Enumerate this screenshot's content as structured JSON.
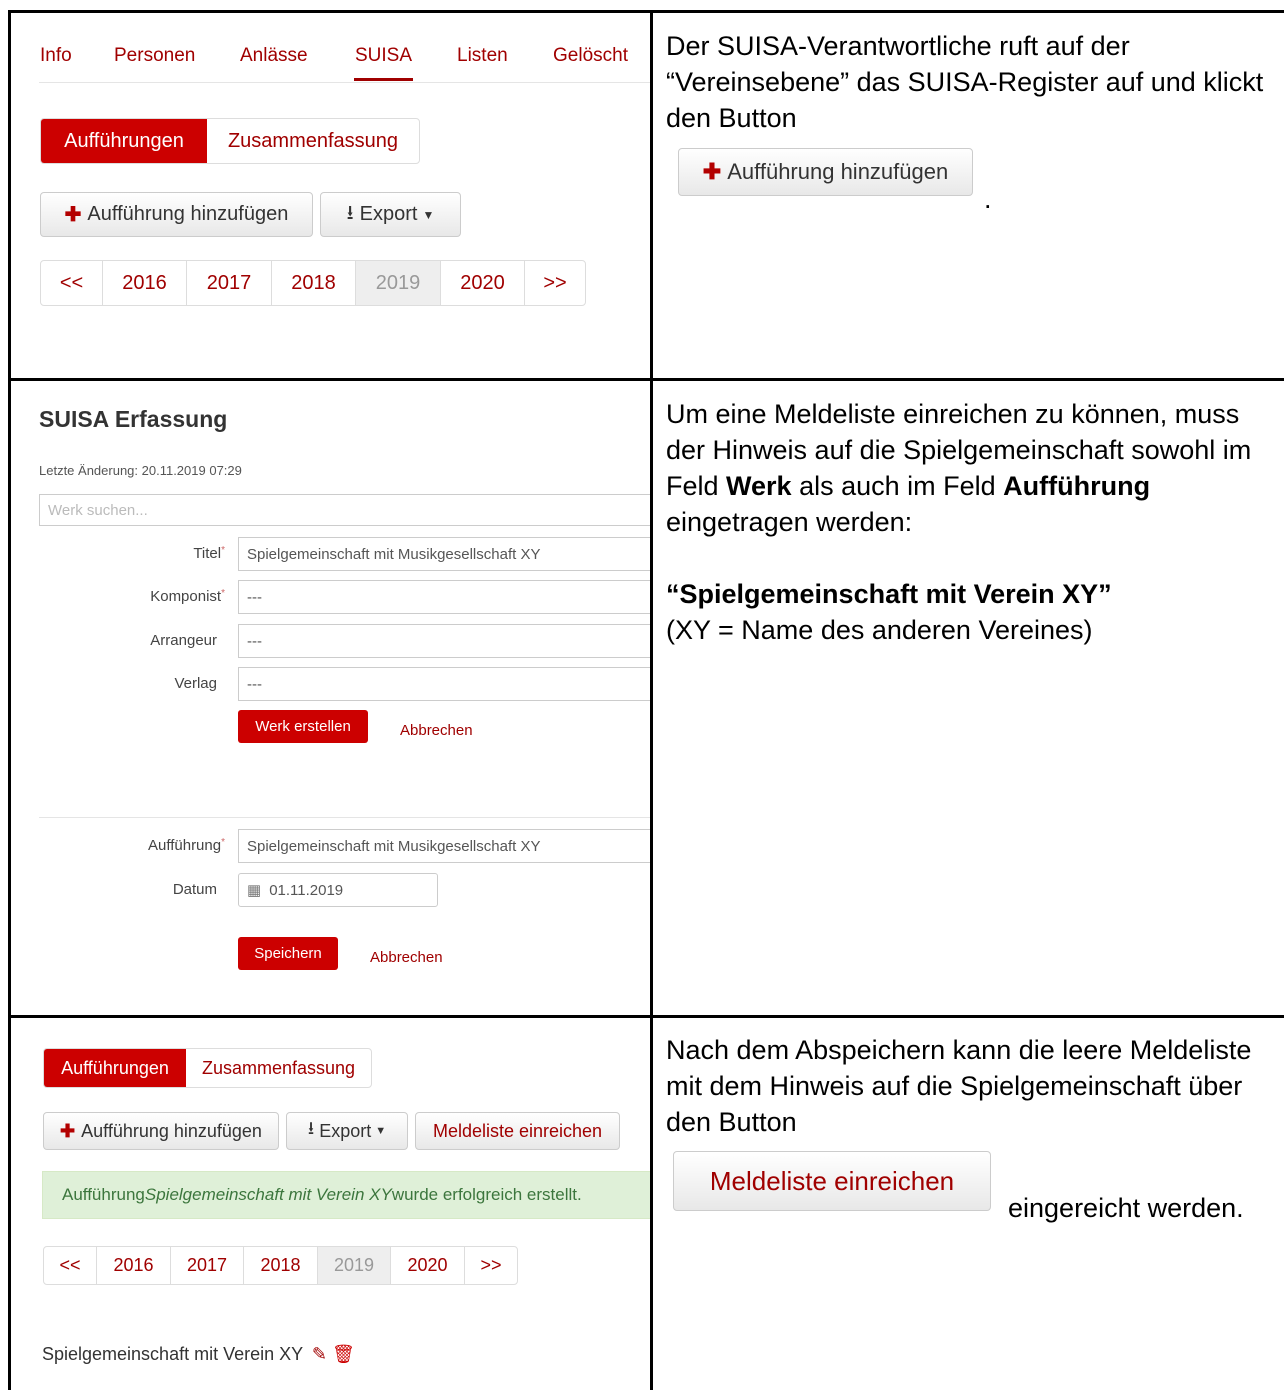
{
  "row1": {
    "nav": [
      "Info",
      "Personen",
      "Anlässe",
      "SUISA",
      "Listen",
      "Gelöscht"
    ],
    "tabs": {
      "active": "Aufführungen",
      "other": "Zusammenfassung"
    },
    "add_button": "Aufführung hinzufügen",
    "export_button": "Export",
    "pager": [
      "<<",
      "2016",
      "2017",
      "2018",
      "2019",
      "2020",
      ">>"
    ],
    "pager_active": "2019",
    "text": "Der SUISA-Verantwortliche ruft auf der “Vereinsebene” das SUISA-Register auf und klickt den Button",
    "inline_button": "Aufführung hinzufügen",
    "trailing_dot": "."
  },
  "row2": {
    "title": "SUISA Erfassung",
    "last_change": "Letzte Änderung: 20.11.2019 07:29",
    "search_placeholder": "Werk suchen...",
    "fields": [
      {
        "label": "Titel",
        "required": "*",
        "value": "Spielgemeinschaft mit Musikgesellschaft XY"
      },
      {
        "label": "Komponist",
        "required": "*",
        "value": "---"
      },
      {
        "label": "Arrangeur",
        "required": "",
        "value": "---"
      },
      {
        "label": "Verlag",
        "required": "",
        "value": "---"
      }
    ],
    "create_button": "Werk erstellen",
    "cancel_link": "Abbrechen",
    "performance_label": "Aufführung",
    "performance_required": "*",
    "performance_value": "Spielgemeinschaft mit Musikgesellschaft XY",
    "date_label": "Datum",
    "date_value": "01.11.2019",
    "save_button": "Speichern",
    "cancel_link2": "Abbrechen",
    "text1_a": "Um eine Meldeliste einreichen zu können, muss der Hinweis auf die Spielgemeinschaft sowohl im Feld ",
    "text1_bold1": "Werk",
    "text1_b": " als auch im Feld ",
    "text1_bold2": "Aufführung",
    "text1_c": " eingetragen werden:",
    "text2_bold": "“Spielgemeinschaft mit Verein XY”",
    "text3": "(XY = Name des anderen Vereines)"
  },
  "row3": {
    "tabs": {
      "active": "Aufführungen",
      "other": "Zusammenfassung"
    },
    "add_button": "Aufführung hinzufügen",
    "export_button": "Export",
    "submit_button": "Meldeliste einreichen",
    "alert_a": "Aufführung ",
    "alert_em": "Spielgemeinschaft mit Verein XY",
    "alert_b": " wurde erfolgreich erstellt.",
    "pager": [
      "<<",
      "2016",
      "2017",
      "2018",
      "2019",
      "2020",
      ">>"
    ],
    "pager_active": "2019",
    "entry": "Spielgemeinschaft mit Verein XY",
    "text": "Nach dem Abspeichern kann die leere Meldeliste mit dem Hinweis auf die Spielgemeinschaft über den Button",
    "inline_button": "Meldeliste einreichen",
    "tail": "eingereicht werden.",
    "colors": {
      "accent": "#cc0000",
      "link": "#a00000",
      "alert_bg": "#dff0d8",
      "alert_text": "#3c763d"
    }
  }
}
